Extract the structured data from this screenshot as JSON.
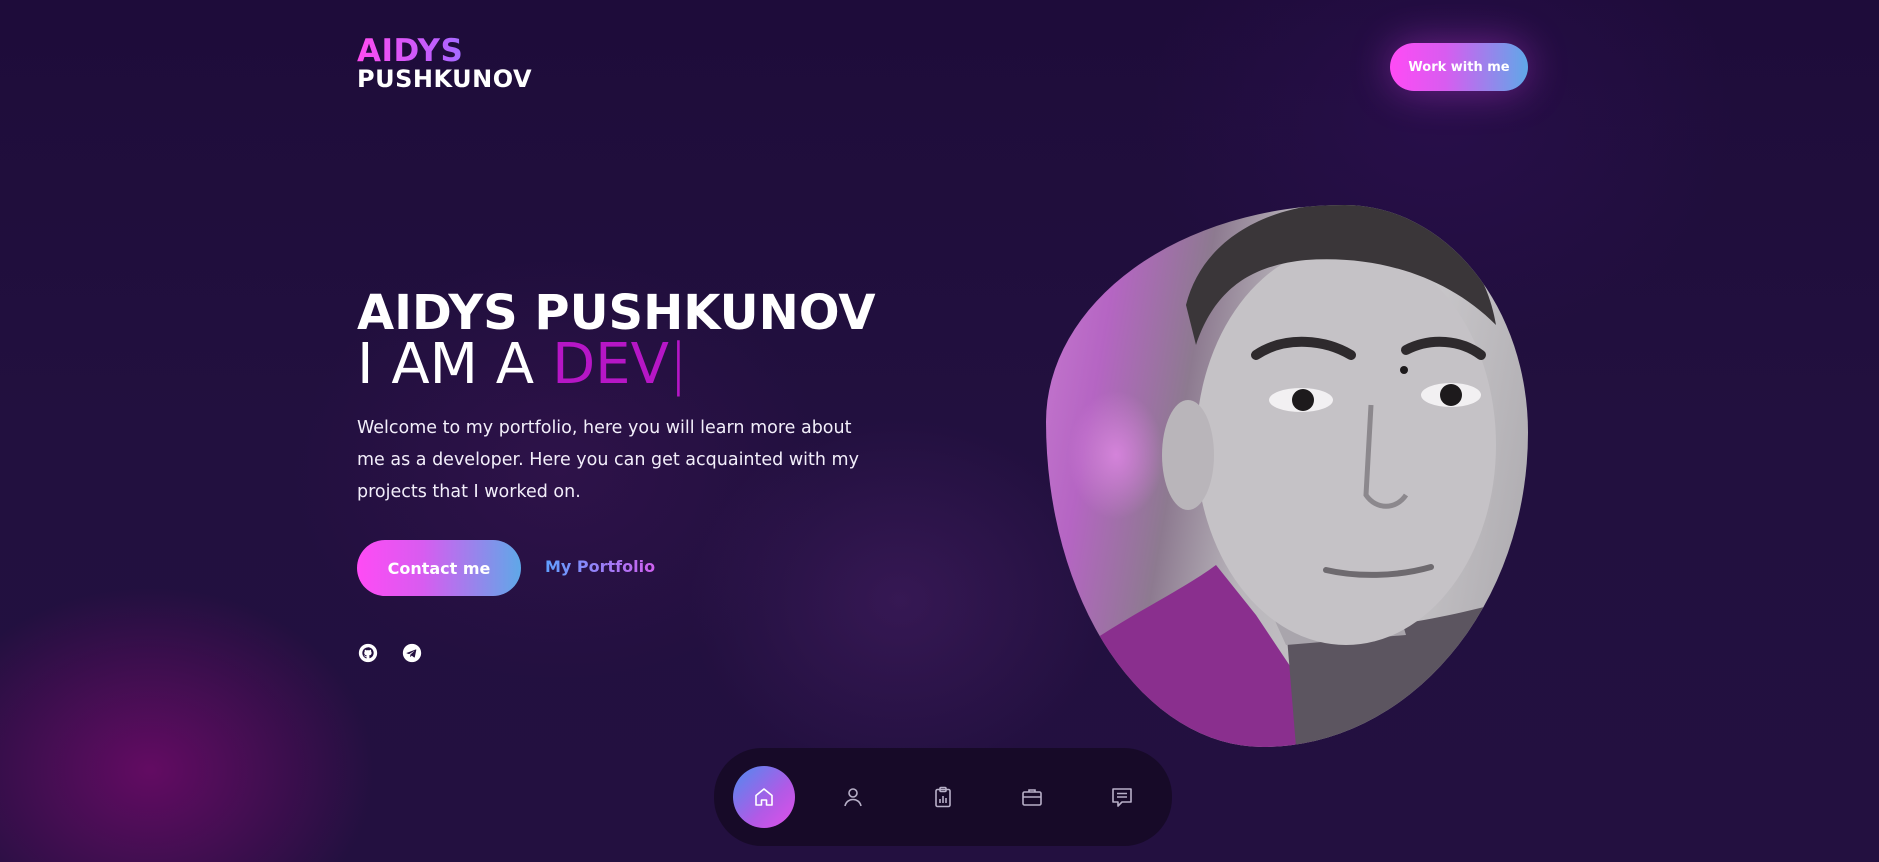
{
  "logo": {
    "line1": "AIDYS",
    "line2": "PUSHKUNOV"
  },
  "header": {
    "cta_label": "Work with me"
  },
  "hero": {
    "name": "AIDYS PUSHKUNOV",
    "prefix": "I AM A",
    "typed_word": "DEV",
    "caret": "|",
    "description": "Welcome to my portfolio, here you will learn more about me as a developer. Here you can get acquainted with my projects that I worked on.",
    "contact_label": "Contact me",
    "portfolio_label": "My Portfolio"
  },
  "social": [
    {
      "icon": "github-icon"
    },
    {
      "icon": "telegram-icon"
    }
  ],
  "nav": {
    "items": [
      {
        "icon": "home-icon",
        "active": true
      },
      {
        "icon": "user-icon",
        "active": false
      },
      {
        "icon": "clipboard-chart-icon",
        "active": false
      },
      {
        "icon": "briefcase-icon",
        "active": false
      },
      {
        "icon": "chat-icon",
        "active": false
      }
    ]
  },
  "colors": {
    "background": "#1f0d3b",
    "accent_pink": "#ff4bf5",
    "accent_blue": "#5fa8e8",
    "typed_word": "#b616c6"
  }
}
